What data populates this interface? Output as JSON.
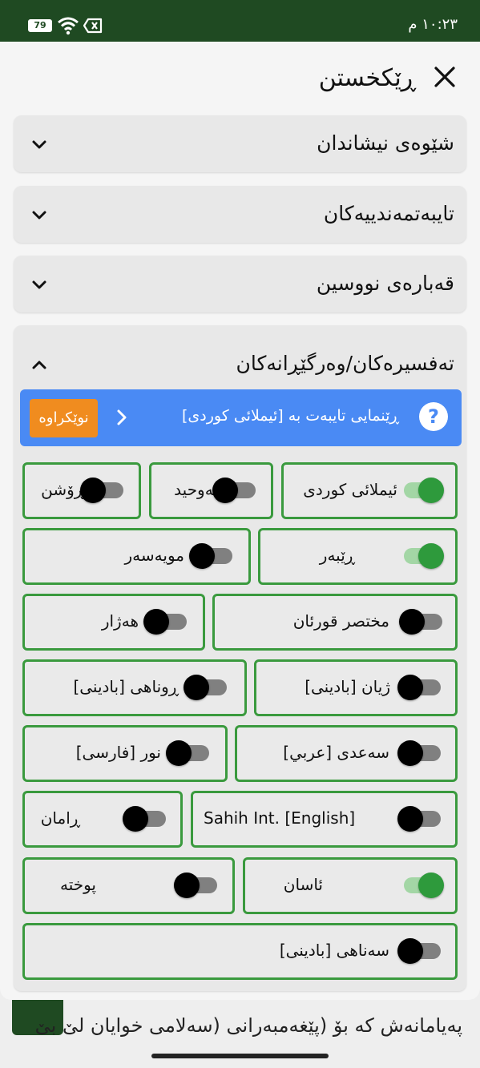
{
  "status_bar": {
    "time": "١٠:٢٣ م",
    "battery": "79"
  },
  "dialog": {
    "title": "ڕێکخستن",
    "sections": [
      {
        "title": "شێوەی نیشاندان",
        "expanded": false
      },
      {
        "title": "تایبەتمەندییەکان",
        "expanded": false
      },
      {
        "title": "قەبارەی نووسین",
        "expanded": false
      },
      {
        "title": "تەفسیرەکان/وەرگێڕانەکان",
        "expanded": true
      }
    ]
  },
  "translations": {
    "banner_text": "ڕێنمایی تایبەت بە [ئیملائی کوردی]",
    "help_icon": "?",
    "new_badge": "نوێکراوە",
    "options": [
      {
        "label": "ئیملائی کوردی",
        "on": true
      },
      {
        "label": "تەوحید",
        "on": false
      },
      {
        "label": "ڕۆشن",
        "on": false
      },
      {
        "label": "ڕێبەر",
        "on": true
      },
      {
        "label": "مویەسەر",
        "on": false
      },
      {
        "label": "مختصر قورئان",
        "on": false
      },
      {
        "label": "هەژار",
        "on": false
      },
      {
        "label": "ژیان [بادینی]",
        "on": false
      },
      {
        "label": "ڕوناهی [بادینی]",
        "on": false
      },
      {
        "label": "سەعدی [عربي]",
        "on": false
      },
      {
        "label": "نور [فارسی]",
        "on": false
      },
      {
        "label": "Sahih Int. [English]",
        "on": false
      },
      {
        "label": "ڕامان",
        "on": false
      },
      {
        "label": "ئاسان",
        "on": true
      },
      {
        "label": "پوختە",
        "on": false
      },
      {
        "label": "سەناهی [بادینی]",
        "on": false
      }
    ]
  },
  "background_text": "پەیامانەش کە بۆ (پێغەمبەرانی (سەلامی خوایان لێ بێ",
  "colors": {
    "status_bar": "#1f4a22",
    "accent_green": "#3a9a3e",
    "banner_blue": "#4a8af4",
    "badge_orange": "#f08c1f"
  }
}
